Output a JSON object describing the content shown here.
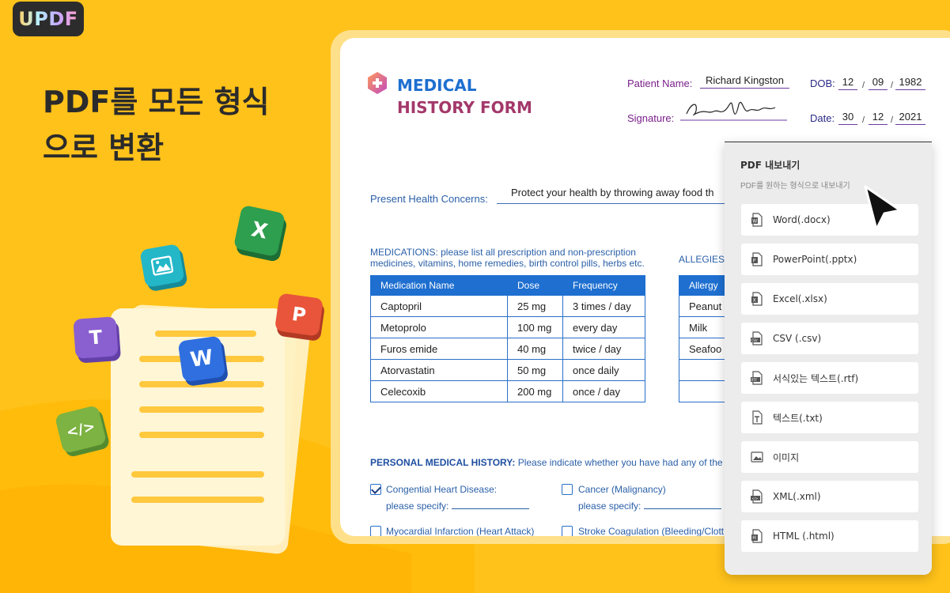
{
  "brand": {
    "logo": "UPDF"
  },
  "headline": {
    "line1": "PDF를 모든 형식",
    "line2": "으로 변환"
  },
  "form": {
    "title_line1": "MEDICAL",
    "title_line2": "HISTORY FORM",
    "patient_name_label": "Patient Name:",
    "patient_name": "Richard Kingston",
    "dob_label": "DOB:",
    "dob_day": "12",
    "dob_month": "09",
    "dob_year": "1982",
    "signature_label": "Signature:",
    "date_label": "Date:",
    "date_day": "30",
    "date_month": "12",
    "date_year": "2021",
    "slash": "/",
    "present_health_label": "Present Health Concerns:",
    "present_health_value": "Protect your health by throwing away food th",
    "medications_heading": "MEDICATIONS:",
    "medications_note": " please list all prescription and non-prescription medicines, vitamins, home remedies, birth control pills, herbs etc.",
    "allergies_heading": "ALLEGIES",
    "med_table": {
      "headers": [
        "Medication Name",
        "Dose",
        "Frequency"
      ],
      "rows": [
        [
          "Captopril",
          "25 mg",
          "3 times / day"
        ],
        [
          "Metoprolo",
          "100 mg",
          "every day"
        ],
        [
          "Furos emide",
          "40 mg",
          "twice / day"
        ],
        [
          "Atorvastatin",
          "50 mg",
          "once daily"
        ],
        [
          "Celecoxib",
          "200 mg",
          "once / day"
        ]
      ]
    },
    "allergy_table": {
      "header": "Allergy",
      "rows": [
        "Peanut",
        "Milk",
        "Seafoo",
        "",
        ""
      ]
    },
    "pmh_heading": "PERSONAL MEDICAL HISTORY:",
    "pmh_note": " Please indicate whether you have had any of the",
    "conditions": [
      {
        "label": "Congential Heart Disease:",
        "checked": true
      },
      {
        "label": "Cancer (Malignancy)",
        "checked": false
      },
      {
        "label": "Myocardial Infarction (Heart Attack)",
        "checked": false
      },
      {
        "label": "Stroke Coagulation (Bleeding/Clott",
        "checked": false
      }
    ],
    "specify_label": "please specify:"
  },
  "export_panel": {
    "title": "PDF 내보내기",
    "subtitle": "PDF를 원하는 형식으로 내보내기",
    "items": [
      {
        "label": "Word(.docx)",
        "icon": "word-file-icon"
      },
      {
        "label": "PowerPoint(.pptx)",
        "icon": "powerpoint-file-icon"
      },
      {
        "label": "Excel(.xlsx)",
        "icon": "excel-file-icon"
      },
      {
        "label": "CSV (.csv)",
        "icon": "csv-file-icon"
      },
      {
        "label": "서식있는 텍스트(.rtf)",
        "icon": "rtf-file-icon"
      },
      {
        "label": "텍스트(.txt)",
        "icon": "text-file-icon"
      },
      {
        "label": "이미지",
        "icon": "image-file-icon"
      },
      {
        "label": "XML(.xml)",
        "icon": "xml-file-icon"
      },
      {
        "label": "HTML (.html)",
        "icon": "html-file-icon"
      }
    ]
  },
  "illustration": {
    "tiles": [
      {
        "letter": "X",
        "icon": "excel-tile-icon",
        "color": "#2e9e4f"
      },
      {
        "letter": "",
        "icon": "image-tile-icon",
        "color": "#23b7c8"
      },
      {
        "letter": "P",
        "icon": "powerpoint-tile-icon",
        "color": "#e8553a"
      },
      {
        "letter": "T",
        "icon": "text-tile-icon",
        "color": "#8a5fd0"
      },
      {
        "letter": "W",
        "icon": "word-tile-icon",
        "color": "#2f6fe0"
      },
      {
        "letter": "</>",
        "icon": "code-tile-icon",
        "color": "#7cb342"
      }
    ]
  },
  "colors": {
    "background": "#FFC21A",
    "form_blue": "#1e6fd0",
    "form_magenta": "#a3386a",
    "panel_bg": "#ececec"
  }
}
